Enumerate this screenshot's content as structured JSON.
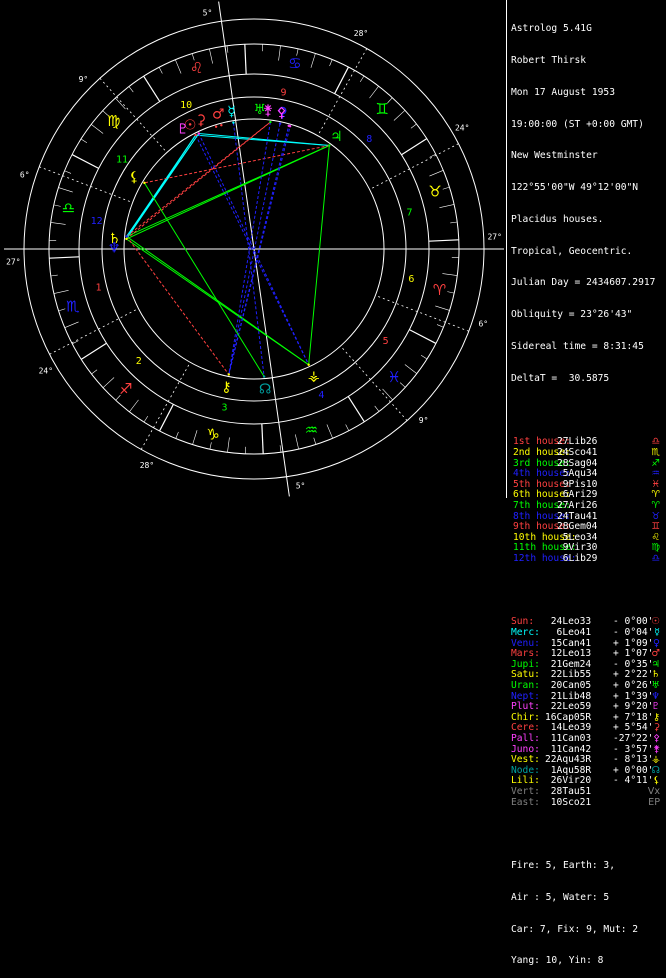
{
  "header": {
    "app": "Astrolog 5.41G",
    "name": "Robert Thirsk",
    "date": "Mon 17 August 1953",
    "time": "19:00:00 (ST +0:00 GMT)",
    "place": "New Westminster",
    "coords": "122°55'00\"W 49°12'00\"N",
    "system": "Placidus houses.",
    "zodiac": "Tropical, Geocentric.",
    "julian": "Julian Day = 2434607.2917",
    "obliquity": "Obliquity = 23°26'43\"",
    "sidereal": "Sidereal time = 8:31:45",
    "deltat": "DeltaT =  30.5875"
  },
  "houses": [
    {
      "label": "1st house:",
      "value": "27Lib26",
      "color": "#ff4040",
      "sym": "♎"
    },
    {
      "label": "2nd house:",
      "value": "24Sco41",
      "color": "#ffff00",
      "sym": "♏"
    },
    {
      "label": "3rd house:",
      "value": "28Sag04",
      "color": "#00ff00",
      "sym": "♐"
    },
    {
      "label": "4th house:",
      "value": "5Aqu34",
      "color": "#2020ff",
      "sym": "♒"
    },
    {
      "label": "5th house:",
      "value": "9Pis10",
      "color": "#ff4040",
      "sym": "♓"
    },
    {
      "label": "6th house:",
      "value": "6Ari29",
      "color": "#ffff00",
      "sym": "♈"
    },
    {
      "label": "7th house:",
      "value": "27Ari26",
      "color": "#00ff00",
      "sym": "♈"
    },
    {
      "label": "8th house:",
      "value": "24Tau41",
      "color": "#2020ff",
      "sym": "♉"
    },
    {
      "label": "9th house:",
      "value": "28Gem04",
      "color": "#ff4040",
      "sym": "♊"
    },
    {
      "label": "10th house:",
      "value": "5Leo34",
      "color": "#ffff00",
      "sym": "♌"
    },
    {
      "label": "11th house:",
      "value": "9Vir30",
      "color": "#00ff00",
      "sym": "♍"
    },
    {
      "label": "12th house:",
      "value": "6Lib29",
      "color": "#2020ff",
      "sym": "♎"
    }
  ],
  "planets": [
    {
      "name": "Sun:",
      "pos": "24Leo33",
      "lat": "- 0°00'",
      "color": "#ff4040",
      "sym": "☉"
    },
    {
      "name": "Merc:",
      "pos": "6Leo41",
      "lat": "- 0°04'",
      "color": "#00ffff",
      "sym": "☿"
    },
    {
      "name": "Venu:",
      "pos": "15Can41",
      "lat": "+ 1°09'",
      "color": "#2020ff",
      "sym": "♀"
    },
    {
      "name": "Mars:",
      "pos": "12Leo13",
      "lat": "+ 1°07'",
      "color": "#ff4040",
      "sym": "♂"
    },
    {
      "name": "Jupi:",
      "pos": "21Gem24",
      "lat": "- 0°35'",
      "color": "#00ff00",
      "sym": "♃"
    },
    {
      "name": "Satu:",
      "pos": "22Lib55",
      "lat": "+ 2°22'",
      "color": "#ffff00",
      "sym": "♄"
    },
    {
      "name": "Uran:",
      "pos": "20Can05",
      "lat": "+ 0°26'",
      "color": "#00ff00",
      "sym": "♅"
    },
    {
      "name": "Nept:",
      "pos": "21Lib48",
      "lat": "+ 1°39'",
      "color": "#2020ff",
      "sym": "♆"
    },
    {
      "name": "Plut:",
      "pos": "22Leo59",
      "lat": "+ 9°20'",
      "color": "#ff40ff",
      "sym": "♇"
    },
    {
      "name": "Chir:",
      "pos": "16Cap05R",
      "lat": "+ 7°18'",
      "color": "#ffff00",
      "sym": "⚷"
    },
    {
      "name": "Cere:",
      "pos": "14Leo39",
      "lat": "+ 5°54'",
      "color": "#ff4040",
      "sym": "⚳"
    },
    {
      "name": "Pall:",
      "pos": "11Can03",
      "lat": "-27°22'",
      "color": "#ff40ff",
      "sym": "⚴"
    },
    {
      "name": "Juno:",
      "pos": "11Can42",
      "lat": "- 3°57'",
      "color": "#ff40ff",
      "sym": "⚵"
    },
    {
      "name": "Vest:",
      "pos": "22Aqu43R",
      "lat": "- 8°13'",
      "color": "#ffff00",
      "sym": "⚶"
    },
    {
      "name": "Node:",
      "pos": "1Aqu58R",
      "lat": "+ 0°00'",
      "color": "#00a0a0",
      "sym": "☊"
    },
    {
      "name": "Lili:",
      "pos": "26Vir20",
      "lat": "- 4°11'",
      "color": "#ffff00",
      "sym": "⚸"
    },
    {
      "name": "Vert:",
      "pos": "28Tau51",
      "lat": "",
      "color": "#808080",
      "sym": "Vx"
    },
    {
      "name": "East:",
      "pos": "10Sco21",
      "lat": "",
      "color": "#808080",
      "sym": "EP"
    }
  ],
  "summary": {
    "line1": "Fire: 5, Earth: 3,",
    "line2": "Air : 5, Water: 5",
    "line3": "Car: 7, Fix: 9, Mut: 2",
    "line4": "Yang: 10, Yin: 8"
  },
  "wheel": {
    "house_numbers": [
      "1",
      "2",
      "3",
      "4",
      "5",
      "6",
      "7",
      "8",
      "9",
      "10",
      "11",
      "12"
    ],
    "cusp_degrees": [
      "27°",
      "24°",
      "28°",
      "5°",
      "9°",
      "6°",
      "27°",
      "24°",
      "28°",
      "5°",
      "9°",
      "6°"
    ],
    "cusp_minutes": [
      "26'",
      "41'",
      "04'",
      "34'",
      "10'",
      "29'",
      "26'",
      "41'",
      "04'",
      "34'",
      "10'",
      "29'"
    ],
    "sign_glyphs": [
      "♈",
      "♉",
      "♊",
      "♋",
      "♌",
      "♍",
      "♎",
      "♏",
      "♐",
      "♑",
      "♒",
      "♓"
    ],
    "colors": {
      "fire": "#ff4040",
      "earth": "#ffff00",
      "air": "#00ff00",
      "water": "#2020ff"
    }
  }
}
